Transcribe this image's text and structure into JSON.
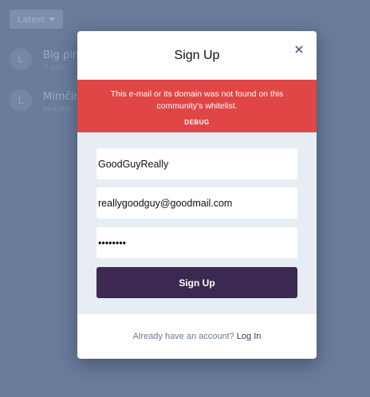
{
  "background": {
    "sort_label": "Latest",
    "discussions": [
      {
        "avatar": "L",
        "title": "Big pim",
        "meta": "↰ Loc"
      },
      {
        "avatar": "L",
        "title": "Mimčin",
        "meta": "apu sun"
      }
    ]
  },
  "modal": {
    "title": "Sign Up",
    "close_glyph": "×",
    "alert": {
      "message": "This e-mail or its domain was not found on this community's whitelist.",
      "debug_label": "DEBUG"
    },
    "fields": {
      "username": "GoodGuyReally",
      "email": "reallygoodguy@goodmail.com",
      "password": "••••••••"
    },
    "submit_label": "Sign Up",
    "footer": {
      "prompt": "Already have an account?",
      "login_label": "Log In"
    }
  },
  "colors": {
    "alert_bg": "#e04646",
    "submit_bg": "#3b2952",
    "form_bg": "#e8edf4",
    "overlay_bg": "#6a7c9c"
  }
}
